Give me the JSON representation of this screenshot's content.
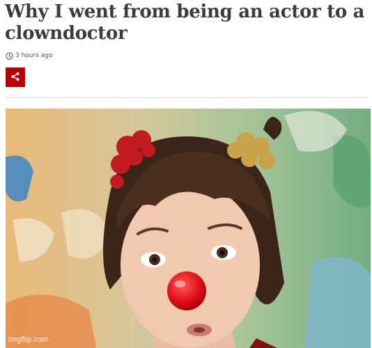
{
  "article": {
    "title": "Why I went from being an actor to a clowndoctor",
    "timestamp": "3 hours ago",
    "share_icon": "share-icon",
    "clock_icon": "clock-icon"
  },
  "image": {
    "watermark": "imgflip.com"
  },
  "colors": {
    "accent": "#b80000",
    "headline": "#3c3c3c"
  }
}
